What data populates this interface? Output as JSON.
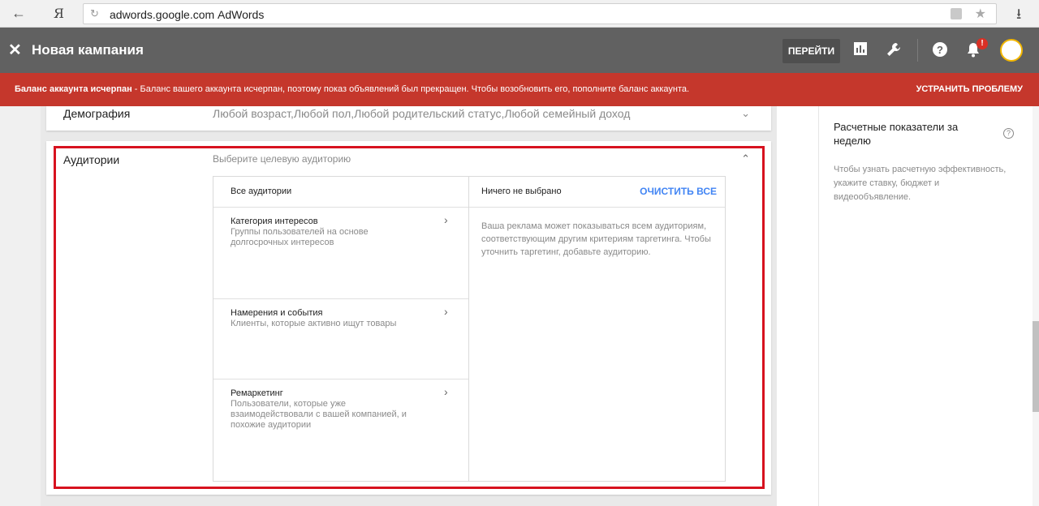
{
  "browser": {
    "back_icon": "←",
    "yandex_logo": "Я",
    "url_host": "adwords.google.com",
    "page_title": "AdWords",
    "reload_icon": "↻",
    "star_icon": "★",
    "download_icon": "⭳"
  },
  "header": {
    "close_icon": "✕",
    "title": "Новая кампания",
    "goto_label": "ПЕРЕЙТИ",
    "notification_badge": "!"
  },
  "alert": {
    "bold": "Баланс аккаунта исчерпан",
    "text": " - Баланс вашего аккаунта исчерпан, поэтому показ объявлений был прекращен. Чтобы возобновить его, пополните баланс аккаунта.",
    "action": "УСТРАНИТЬ ПРОБЛЕМУ"
  },
  "demography": {
    "label": "Демография",
    "value": "Любой возраст,Любой пол,Любой родительский статус,Любой семейный доход",
    "chevron": "⌄"
  },
  "audiences": {
    "label": "Аудитории",
    "subtitle": "Выберите целевую аудиторию",
    "chevron": "⌃",
    "left_header": "Все аудитории",
    "items": [
      {
        "title": "Категория интересов",
        "desc": "Группы пользователей на основе долгосрочных интересов"
      },
      {
        "title": "Намерения и события",
        "desc": "Клиенты, которые активно ищут товары"
      },
      {
        "title": "Ремаркетинг",
        "desc": "Пользователи, которые уже взаимодействовали с вашей компанией, и похожие аудитории"
      }
    ],
    "right_header": "Ничего не выбрано",
    "clear_all": "ОЧИСТИТЬ ВСЕ",
    "empty_desc": "Ваша реклама может показываться всем аудиториям, соответствующим другим критериям таргетинга. Чтобы уточнить таргетинг, добавьте аудиторию."
  },
  "sidebar": {
    "title": "Расчетные показатели за неделю",
    "help": "?",
    "desc": "Чтобы узнать расчетную эффективность, укажите ставку, бюджет и видеообъявление."
  },
  "colors": {
    "header_bg": "#616161",
    "alert_bg": "#c5372c",
    "accent_blue": "#4285f4",
    "highlight_red": "#d7121f"
  }
}
